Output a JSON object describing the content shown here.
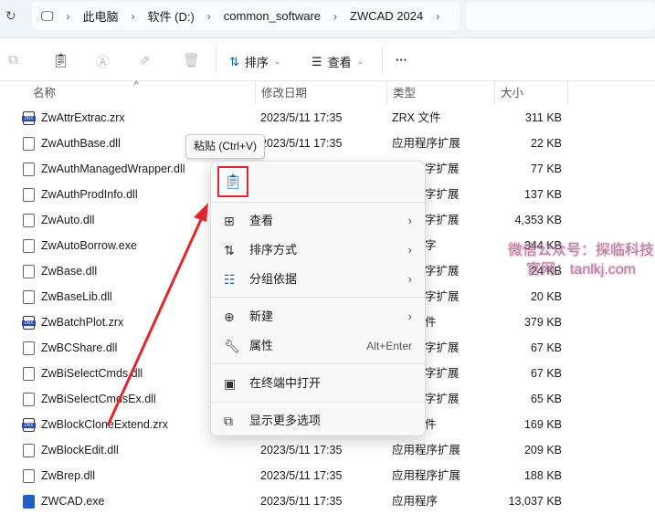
{
  "breadcrumb": [
    "此电脑",
    "软件 (D:)",
    "common_software",
    "ZWCAD 2024"
  ],
  "toolbar": {
    "sort": "排序",
    "view": "查看",
    "more": "···"
  },
  "columns": {
    "name": "名称",
    "date": "修改日期",
    "type": "类型",
    "size": "大小"
  },
  "files": [
    {
      "name": "ZwAttrExtrac.zrx",
      "date": "2023/5/11 17:35",
      "type": "ZRX 文件",
      "size": "311 KB",
      "icon": "zrx"
    },
    {
      "name": "ZwAuthBase.dll",
      "date": "2023/5/11 17:35",
      "type": "应用程序扩展",
      "size": "22 KB",
      "icon": "dll"
    },
    {
      "name": "ZwAuthManagedWrapper.dll",
      "date": "",
      "type": "字扩展",
      "size": "77 KB",
      "icon": "dll"
    },
    {
      "name": "ZwAuthProdInfo.dll",
      "date": "",
      "type": "字扩展",
      "size": "137 KB",
      "icon": "dll"
    },
    {
      "name": "ZwAuto.dll",
      "date": "",
      "type": "字扩展",
      "size": "4,353 KB",
      "icon": "dll"
    },
    {
      "name": "ZwAutoBorrow.exe",
      "date": "",
      "type": "字",
      "size": "344 KB",
      "icon": "exe-lock"
    },
    {
      "name": "ZwBase.dll",
      "date": "",
      "type": "字扩展",
      "size": "24 KB",
      "icon": "dll"
    },
    {
      "name": "ZwBaseLib.dll",
      "date": "",
      "type": "字扩展",
      "size": "20 KB",
      "icon": "dll"
    },
    {
      "name": "ZwBatchPlot.zrx",
      "date": "",
      "type": "件",
      "size": "379 KB",
      "icon": "zrx"
    },
    {
      "name": "ZwBCShare.dll",
      "date": "",
      "type": "字扩展",
      "size": "67 KB",
      "icon": "dll"
    },
    {
      "name": "ZwBiSelectCmds.dll",
      "date": "",
      "type": "字扩展",
      "size": "67 KB",
      "icon": "dll"
    },
    {
      "name": "ZwBiSelectCmdsEx.dll",
      "date": "",
      "type": "字扩展",
      "size": "65 KB",
      "icon": "dll"
    },
    {
      "name": "ZwBlockCloneExtend.zrx",
      "date": "",
      "type": "件",
      "size": "169 KB",
      "icon": "zrx"
    },
    {
      "name": "ZwBlockEdit.dll",
      "date": "2023/5/11 17:35",
      "type": "应用程序扩展",
      "size": "209 KB",
      "icon": "dll"
    },
    {
      "name": "ZwBrep.dll",
      "date": "2023/5/11 17:35",
      "type": "应用程序扩展",
      "size": "188 KB",
      "icon": "dll"
    },
    {
      "name": "ZWCAD.exe",
      "date": "2023/5/11 17:35",
      "type": "应用程序",
      "size": "13,037 KB",
      "icon": "exe"
    }
  ],
  "tooltip": "粘贴 (Ctrl+V)",
  "menu": {
    "view": "查看",
    "sort": "排序方式",
    "group": "分组依据",
    "new": "新建",
    "properties": "属性",
    "properties_shortcut": "Alt+Enter",
    "terminal": "在终端中打开",
    "more": "显示更多选项"
  },
  "watermark": {
    "line1": "微信公众号：探临科技",
    "line2": "官网：tanlkj.com"
  },
  "colors": {
    "highlight": "#e0282c",
    "accent": "#1f5fbf"
  }
}
